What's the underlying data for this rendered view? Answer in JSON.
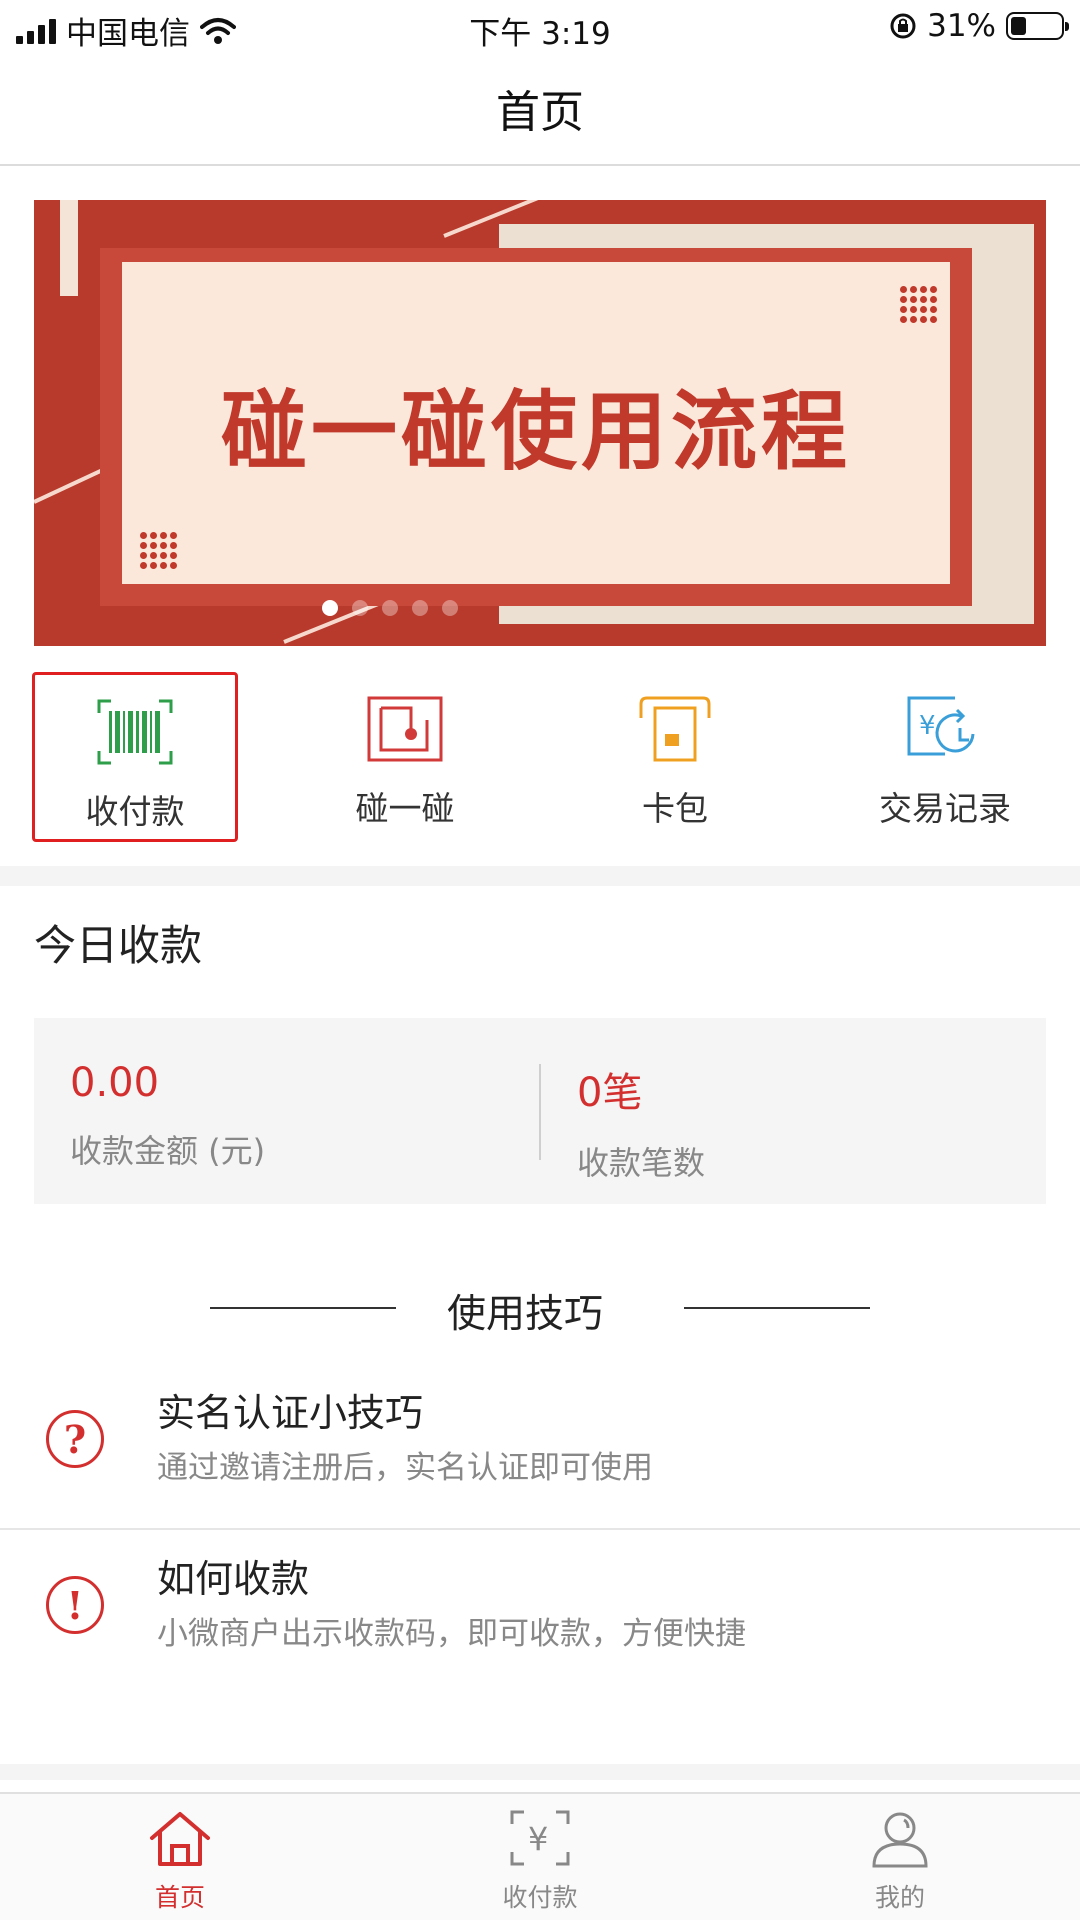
{
  "status_bar": {
    "carrier": "中国电信",
    "time": "下午 3:19",
    "battery": "31%",
    "battery_level": 0.31
  },
  "header": {
    "title": "首页"
  },
  "banner": {
    "text": "碰一碰使用流程",
    "page_count": 5,
    "active_index": 0
  },
  "quick_menu": [
    {
      "label": "收付款",
      "icon": "barcode-scan-icon",
      "selected": true
    },
    {
      "label": "碰一碰",
      "icon": "tap-nfc-icon",
      "selected": false
    },
    {
      "label": "卡包",
      "icon": "card-wallet-icon",
      "selected": false
    },
    {
      "label": "交易记录",
      "icon": "transaction-record-icon",
      "selected": false
    }
  ],
  "today": {
    "title": "今日收款",
    "amount_value": "0.00",
    "amount_label": "收款金额 (元)",
    "count_value": "0笔",
    "count_label": "收款笔数"
  },
  "tips": {
    "heading": "使用技巧",
    "items": [
      {
        "icon": "question-icon",
        "symbol": "?",
        "title": "实名认证小技巧",
        "desc": "通过邀请注册后，实名认证即可使用"
      },
      {
        "icon": "exclamation-icon",
        "symbol": "!",
        "title": "如何收款",
        "desc": "小微商户出示收款码，即可收款，方便快捷"
      }
    ]
  },
  "tab_bar": [
    {
      "label": "首页",
      "icon": "home-icon",
      "active": true
    },
    {
      "label": "收付款",
      "icon": "yuan-scan-icon",
      "active": false
    },
    {
      "label": "我的",
      "icon": "user-icon",
      "active": false
    }
  ],
  "colors": {
    "accent": "#d32f2f",
    "banner_red": "#b83a2c",
    "barcode_green": "#2e9e4a",
    "tap_red": "#d23a3a",
    "card_orange": "#f0a020",
    "record_blue": "#3a9fd8"
  }
}
